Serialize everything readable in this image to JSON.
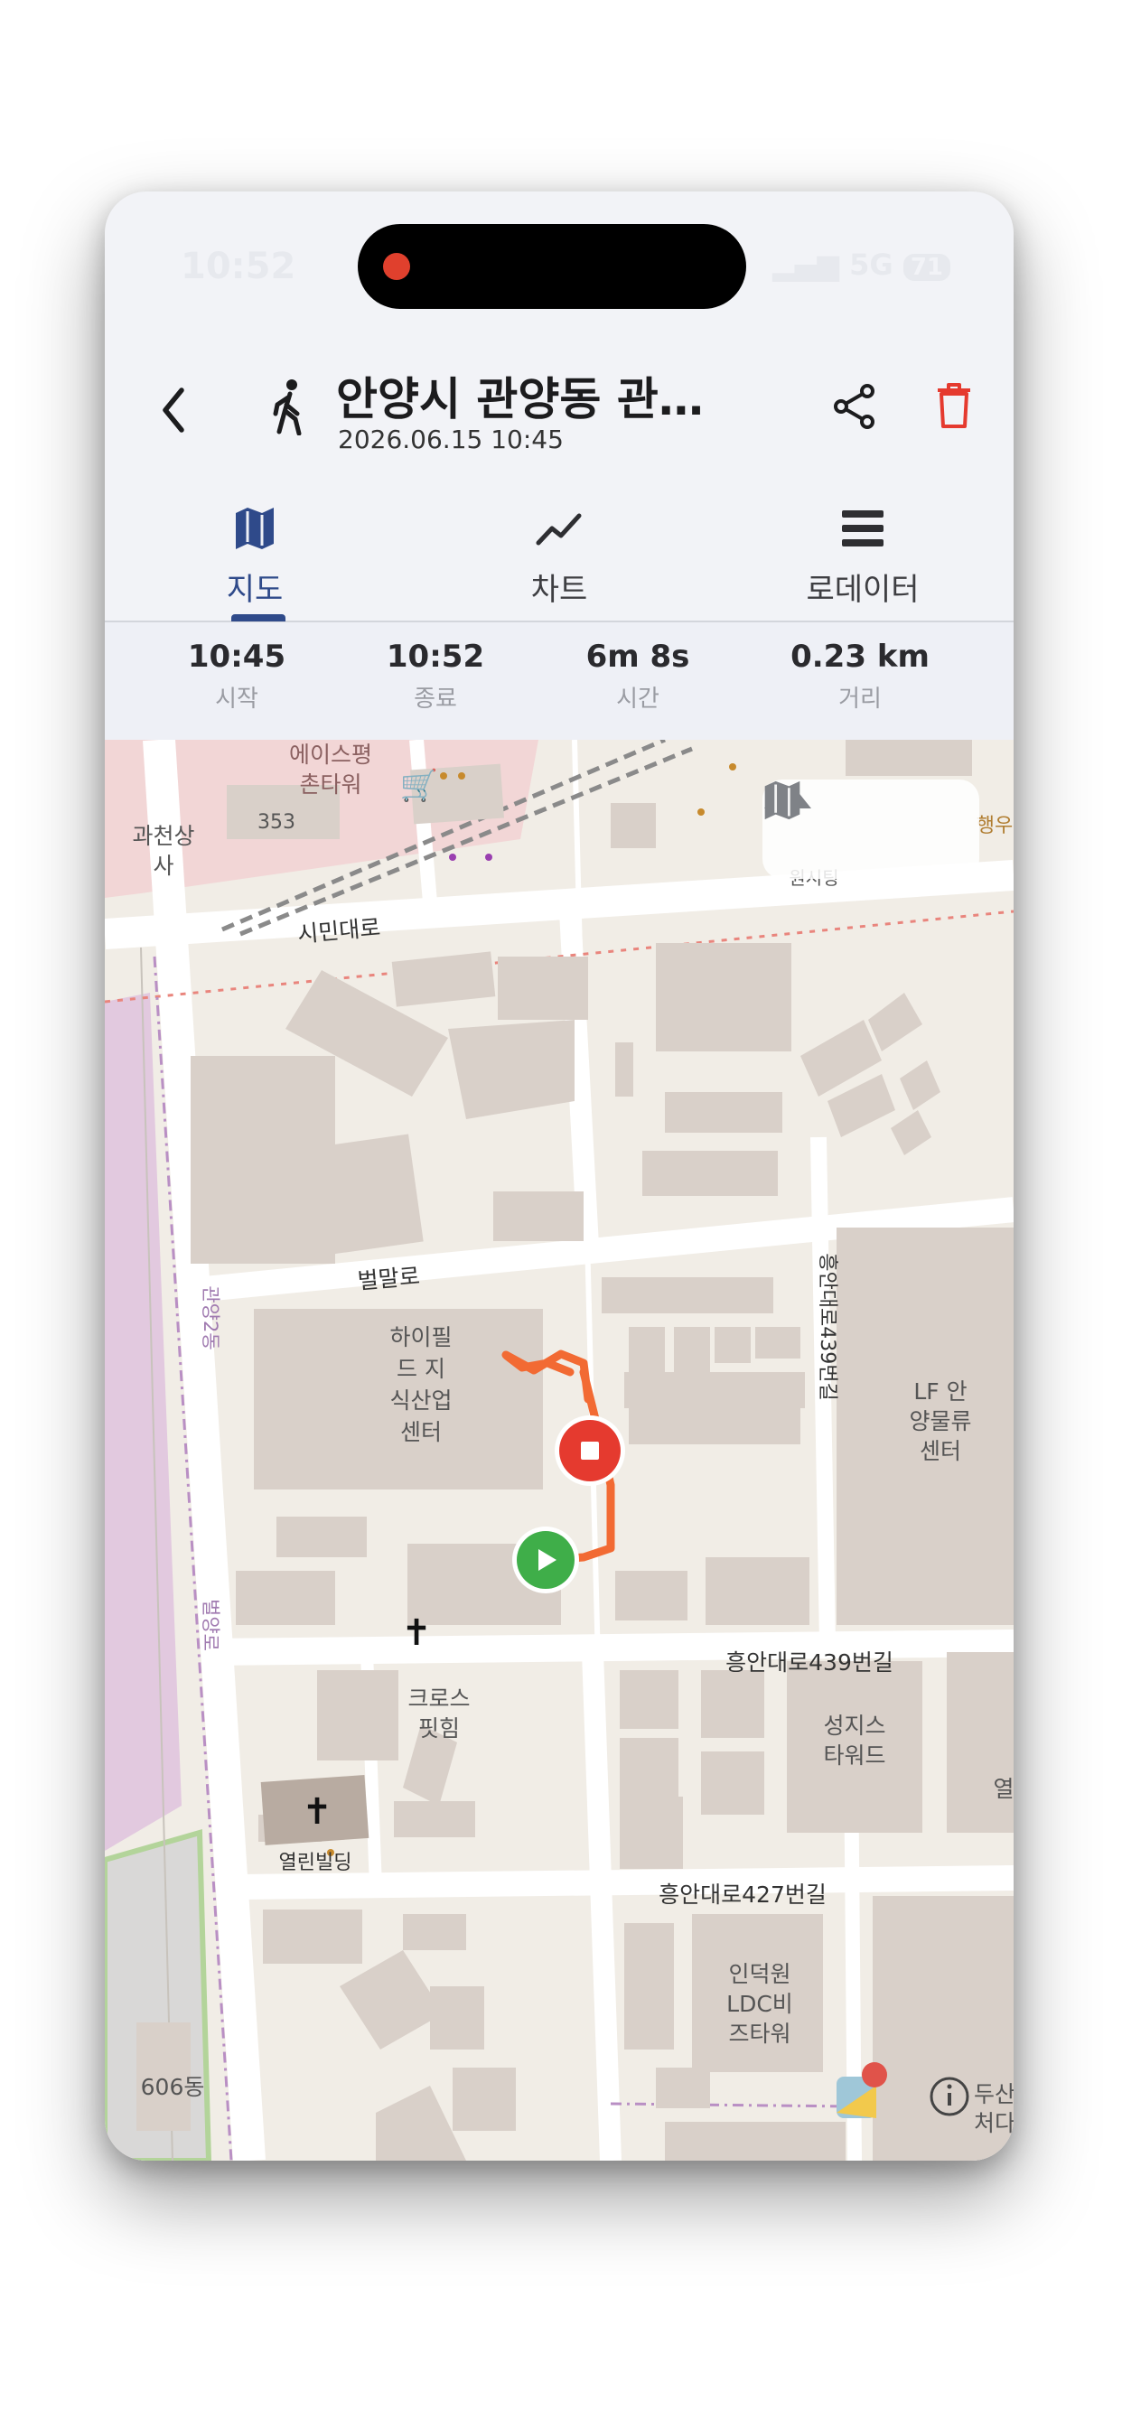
{
  "status": {
    "time": "10:52",
    "network": "5G",
    "battery": "71"
  },
  "header": {
    "title": "안양시 관양동 관양…",
    "datetime": "2026.06.15 10:45"
  },
  "tabs": [
    {
      "label": "지도",
      "icon": "map-icon",
      "active": true
    },
    {
      "label": "차트",
      "icon": "chart-icon",
      "active": false
    },
    {
      "label": "로데이터",
      "icon": "list-icon",
      "active": false
    }
  ],
  "stats": [
    {
      "value": "10:45",
      "label": "시작"
    },
    {
      "value": "10:52",
      "label": "종료"
    },
    {
      "value": "6m 8s",
      "label": "시간"
    },
    {
      "value": "0.23 km",
      "label": "거리"
    }
  ],
  "map": {
    "labels": {
      "ace": "에이스평",
      "ace2": "촌타워",
      "bldg353": "353",
      "gwacheon": "과천상",
      "gwacheon2": "사",
      "simin": "시민대로",
      "byeolmal": "벌말로",
      "gwanyang2": "관양2동",
      "byeolyang": "벌양로",
      "hifield1": "하이필",
      "hifield2": "드 지",
      "hifield3": "식산업",
      "hifield4": "센터",
      "heungan439": "흥안대로439번길",
      "heungan439v": "흥안대로439번길",
      "lf1": "LF 안",
      "lf2": "양물류",
      "lf3": "센터",
      "cross1": "크로스",
      "cross2": "핏힘",
      "yeolin": "열린빌딩",
      "seongji1": "성지스",
      "seongji2": "타워드",
      "heungan427": "흥안대로427번길",
      "induk1": "인덕원",
      "induk2": "LDC비",
      "induk3": "즈타워",
      "dong606": "606동",
      "dusan1": "두산",
      "dusan2": "처다",
      "hang": "행우",
      "yeol": "열",
      "cut": "원시팅"
    }
  }
}
